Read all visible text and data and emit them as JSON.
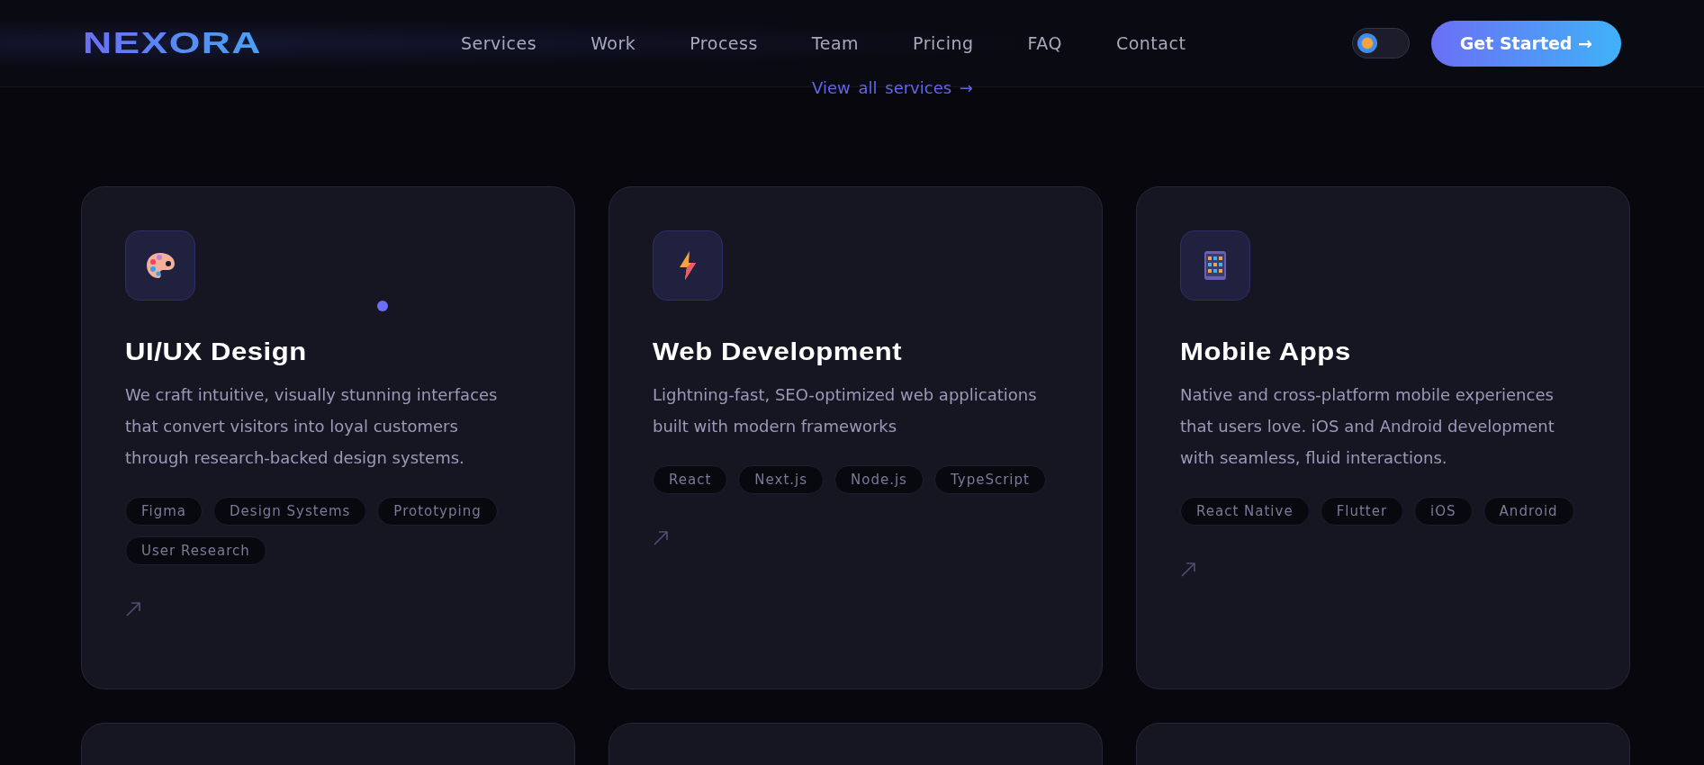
{
  "header": {
    "logo": "NEXORA",
    "nav": [
      {
        "label": "Services"
      },
      {
        "label": "Work"
      },
      {
        "label": "Process"
      },
      {
        "label": "Team"
      },
      {
        "label": "Pricing"
      },
      {
        "label": "FAQ"
      },
      {
        "label": "Contact"
      }
    ],
    "theme_toggle": {
      "on": false
    },
    "cta": "Get Started →"
  },
  "view_all_link": "View all services →",
  "services": [
    {
      "title": "UI/UX Design",
      "description": "We craft intuitive, visually stunning interfaces that convert visitors into loyal customers through research-backed design systems.",
      "tags": [
        "Figma",
        "Design Systems",
        "Prototyping",
        "User Research"
      ]
    },
    {
      "title": "Web Development",
      "description": "Lightning-fast, SEO-optimized web applications built with modern frameworks",
      "tags": [
        "React",
        "Next.js",
        "Node.js",
        "TypeScript"
      ]
    },
    {
      "title": "Mobile Apps",
      "description": "Native and cross-platform mobile experiences that users love. iOS and Android development with seamless, fluid interactions.",
      "tags": [
        "React Native",
        "Flutter",
        "iOS",
        "Android"
      ]
    }
  ]
}
